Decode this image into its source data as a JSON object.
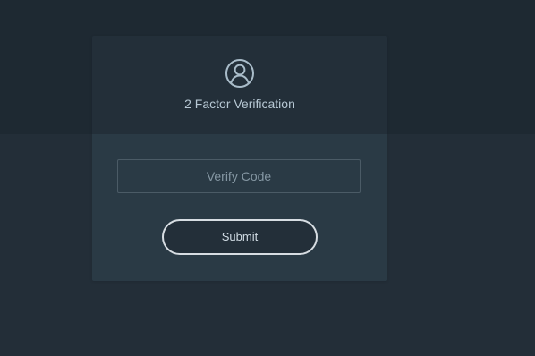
{
  "page": {
    "background_color": "#232e38",
    "top_band_color": "#1e2932"
  },
  "card": {
    "icon_name": "user-circle-icon",
    "title": "2 Factor Verification",
    "verify_code_placeholder": "Verify Code",
    "verify_code_value": "",
    "submit_label": "Submit"
  },
  "colors": {
    "card_header": "#232f39",
    "card_body": "#2a3a45",
    "icon_stroke": "#a9bcc9",
    "title_text": "#b7c8d4",
    "input_border": "#4b5b66",
    "placeholder_text": "#8597a3",
    "button_border": "#d7dde2",
    "button_text": "#d0dbe3"
  }
}
